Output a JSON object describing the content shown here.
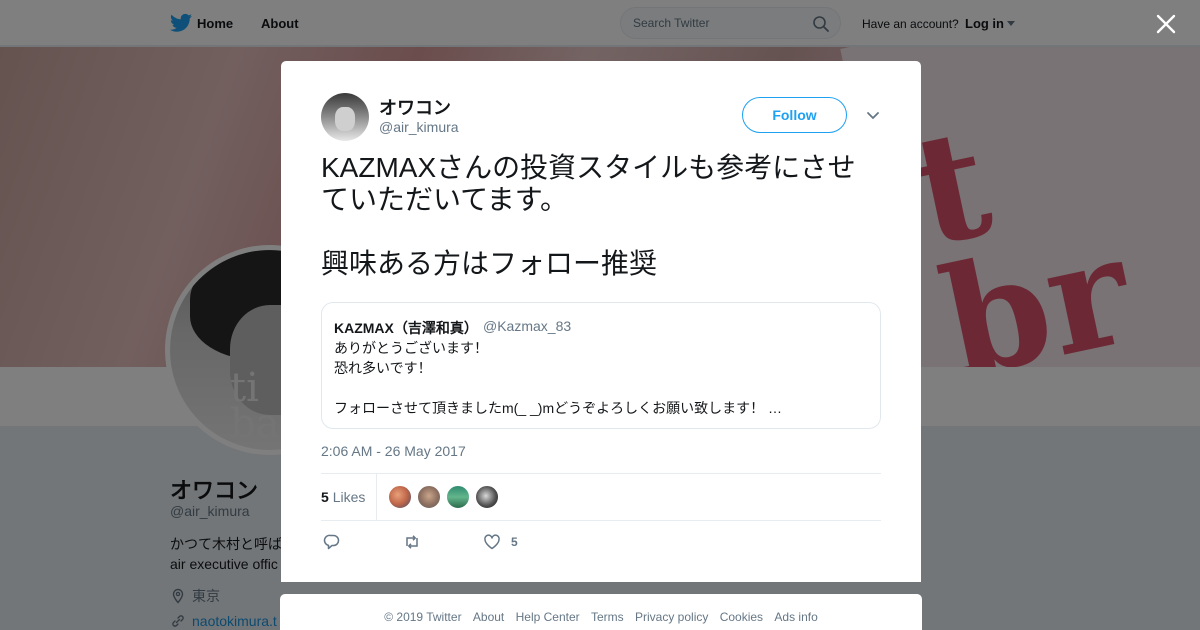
{
  "nav": {
    "home_label": "Home",
    "about_label": "About",
    "search_placeholder": "Search Twitter",
    "account_prompt": "Have an account?",
    "login_label": "Log in",
    "brand_color": "#1da1f2"
  },
  "profile": {
    "name": "オワコン",
    "handle": "@air_kimura",
    "bio": "かつて木村と呼ば\nair executive offic",
    "location": "東京",
    "link": "naotokimura.t",
    "avatar_text": "ti\nba"
  },
  "tweet": {
    "author_name": "オワコン",
    "author_handle": "@air_kimura",
    "follow_label": "Follow",
    "text": "KAZMAXさんの投資スタイルも参考にさせていただいてます。\n\n興味ある方はフォロー推奨",
    "quoted": {
      "name": "KAZMAX（吉澤和真）",
      "handle": "@Kazmax_83",
      "text": "ありがとうございます！\n恐れ多いです！\n\nフォローさせて頂きましたm(_ _)mどうぞよろしくお願い致します！ …"
    },
    "timestamp": "2:06 AM - 26 May 2017",
    "likes_count": "5",
    "likes_label": "Likes",
    "like_action_count": "5"
  },
  "footer": {
    "links": [
      "© 2019 Twitter",
      "About",
      "Help Center",
      "Terms",
      "Privacy policy",
      "Cookies",
      "Ads info"
    ]
  }
}
